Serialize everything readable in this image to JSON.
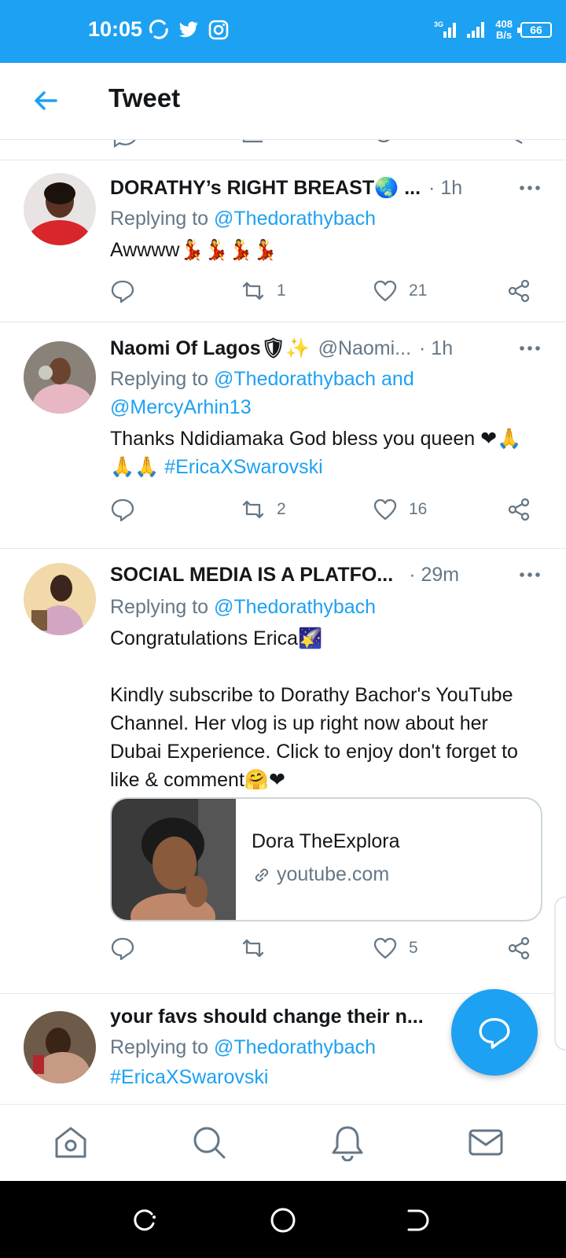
{
  "status_bar": {
    "time": "10:05",
    "net_speed_value": "408",
    "net_speed_unit": "B/s",
    "battery": "66",
    "icons": [
      "sync-icon",
      "twitter-icon",
      "instagram-icon",
      "signal-icon",
      "wifi-bars-icon",
      "battery-icon"
    ]
  },
  "header": {
    "title": "Tweet",
    "back_icon": "arrow-left-icon"
  },
  "tweets": [
    {
      "name": "DORATHY’s RIGHT BREAST🌏 ...",
      "handle": "",
      "time": "· 1h",
      "replying_prefix": "Replying to ",
      "replying_to": "@Thedorathybach",
      "text": "Awwww💃💃💃💃",
      "reply_count": "",
      "retweet_count": "1",
      "like_count": "21"
    },
    {
      "name": "Naomi Of Lagos🛡✨",
      "handle": "@Naomi...",
      "time": "· 1h",
      "replying_prefix": "Replying to ",
      "replying_to": "@Thedorathybach and @MercyArhin13",
      "text_plain": "Thanks Ndidiamaka God bless you queen ❤🙏🙏🙏 ",
      "text_link": "#EricaXSwarovski",
      "reply_count": "",
      "retweet_count": "2",
      "like_count": "16"
    },
    {
      "name": "SOCIAL MEDIA IS A PLATFO...",
      "handle": "",
      "time": "· 29m",
      "replying_prefix": "Replying to ",
      "replying_to": "@Thedorathybach",
      "text": "Congratulations Erica🌠\n\nKindly subscribe to Dorathy Bachor's YouTube Channel. Her vlog is up right now about her Dubai Experience. Click to enjoy don't forget to like & comment🤗❤",
      "card": {
        "title": "Dora TheExplora",
        "domain": "youtube.com"
      },
      "reply_count": "",
      "retweet_count": "",
      "like_count": "5"
    },
    {
      "name": "your favs should change their n...",
      "handle": "",
      "time": "",
      "replying_prefix": "Replying to ",
      "replying_to": "@Thedorathybach",
      "text_link": "#EricaXSwarovski"
    }
  ],
  "bottom_nav": [
    "home-icon",
    "search-icon",
    "notifications-icon",
    "messages-icon"
  ],
  "colors": {
    "brand": "#1da1f2",
    "text": "#14171a",
    "secondary": "#657786",
    "border": "#e1e8ed"
  }
}
